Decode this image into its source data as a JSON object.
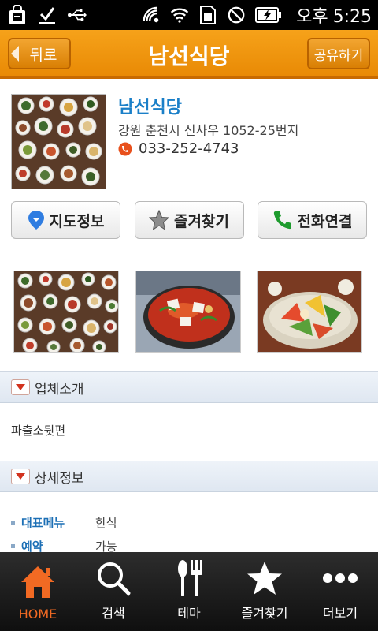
{
  "status_bar": {
    "ampm": "오후",
    "time": "5:25"
  },
  "header": {
    "back_label": "뒤로",
    "title": "남선식당",
    "share_label": "공유하기"
  },
  "restaurant": {
    "name": "남선식당",
    "address": "강원 춘천시 신사우 1052-25번지",
    "phone": "033-252-4743"
  },
  "actions": [
    {
      "label": "지도정보",
      "icon": "map-pin-icon"
    },
    {
      "label": "즐겨찾기",
      "icon": "star-icon"
    },
    {
      "label": "전화연결",
      "icon": "phone-icon"
    }
  ],
  "sections": {
    "intro": {
      "title": "업체소개",
      "text": "파출소뒷편"
    },
    "details": {
      "title": "상세정보",
      "rows": [
        {
          "label": "대표메뉴",
          "value": "한식"
        },
        {
          "label": "예약",
          "value": "가능"
        }
      ]
    }
  },
  "bottom_nav": [
    {
      "label": "HOME",
      "icon": "home-icon",
      "active": true
    },
    {
      "label": "검색",
      "icon": "search-icon",
      "active": false
    },
    {
      "label": "테마",
      "icon": "utensils-icon",
      "active": false
    },
    {
      "label": "즐겨찾기",
      "icon": "star-icon",
      "active": false
    },
    {
      "label": "더보기",
      "icon": "more-dots-icon",
      "active": false
    }
  ],
  "colors": {
    "header_orange": "#ee9510",
    "accent_blue": "#1a7fc8",
    "nav_active": "#f26a23"
  }
}
